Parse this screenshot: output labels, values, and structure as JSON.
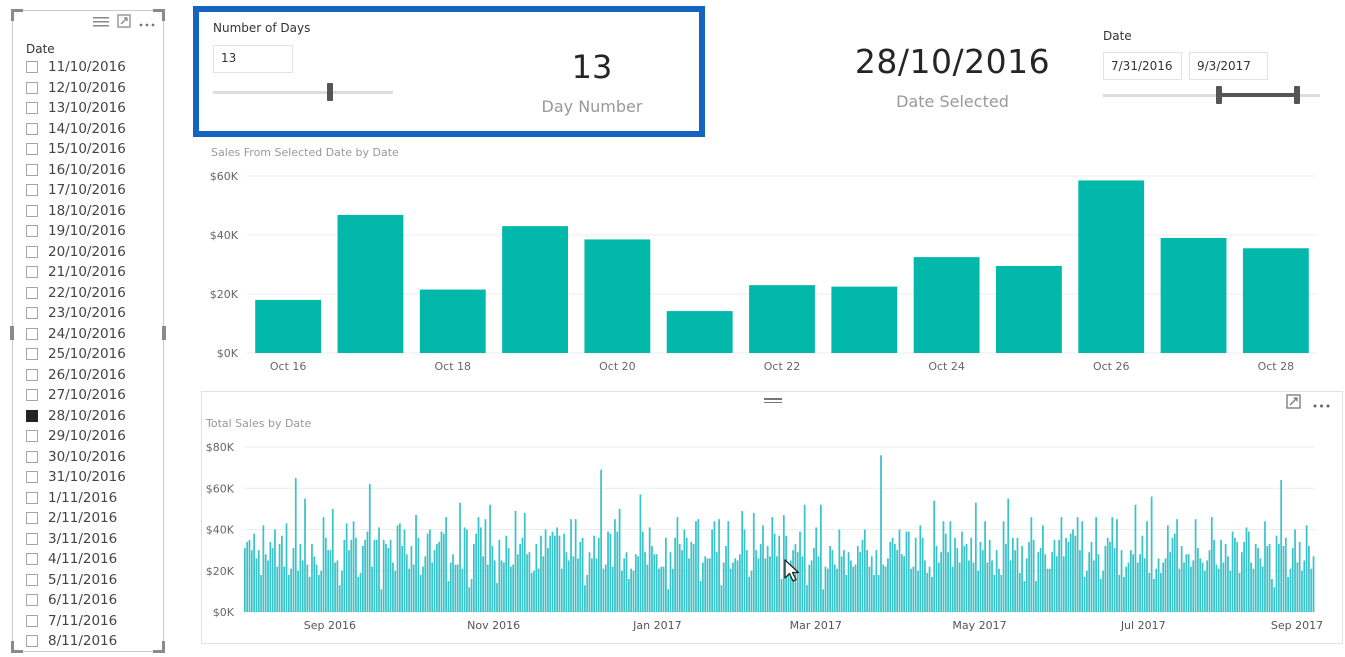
{
  "date_slicer": {
    "title": "Date",
    "items": [
      {
        "label": "11/10/2016",
        "checked": false
      },
      {
        "label": "12/10/2016",
        "checked": false
      },
      {
        "label": "13/10/2016",
        "checked": false
      },
      {
        "label": "14/10/2016",
        "checked": false
      },
      {
        "label": "15/10/2016",
        "checked": false
      },
      {
        "label": "16/10/2016",
        "checked": false
      },
      {
        "label": "17/10/2016",
        "checked": false
      },
      {
        "label": "18/10/2016",
        "checked": false
      },
      {
        "label": "19/10/2016",
        "checked": false
      },
      {
        "label": "20/10/2016",
        "checked": false
      },
      {
        "label": "21/10/2016",
        "checked": false
      },
      {
        "label": "22/10/2016",
        "checked": false
      },
      {
        "label": "23/10/2016",
        "checked": false
      },
      {
        "label": "24/10/2016",
        "checked": false
      },
      {
        "label": "25/10/2016",
        "checked": false
      },
      {
        "label": "26/10/2016",
        "checked": false
      },
      {
        "label": "27/10/2016",
        "checked": false
      },
      {
        "label": "28/10/2016",
        "checked": true
      },
      {
        "label": "29/10/2016",
        "checked": false
      },
      {
        "label": "30/10/2016",
        "checked": false
      },
      {
        "label": "31/10/2016",
        "checked": false
      },
      {
        "label": "1/11/2016",
        "checked": false
      },
      {
        "label": "2/11/2016",
        "checked": false
      },
      {
        "label": "3/11/2016",
        "checked": false
      },
      {
        "label": "4/11/2016",
        "checked": false
      },
      {
        "label": "5/11/2016",
        "checked": false
      },
      {
        "label": "6/11/2016",
        "checked": false
      },
      {
        "label": "7/11/2016",
        "checked": false
      },
      {
        "label": "8/11/2016",
        "checked": false
      }
    ],
    "icons": [
      "menu-lines-icon",
      "focus-mode-icon",
      "more-options-icon"
    ]
  },
  "number_of_days": {
    "title": "Number of Days",
    "input_value": "13",
    "slider_fraction": 0.65,
    "highlight_color": "#1565c0"
  },
  "day_number_card": {
    "value": "13",
    "caption": "Day Number"
  },
  "date_selected_card": {
    "value": "28/10/2016",
    "caption": "Date Selected"
  },
  "date_range": {
    "title": "Date",
    "start": "7/31/2016",
    "end": "9/3/2017"
  },
  "chart_data": [
    {
      "type": "bar",
      "title": "Sales From Selected Date by Date",
      "xlabel": "",
      "ylabel": "",
      "categories": [
        "Oct 16",
        "Oct 17",
        "Oct 18",
        "Oct 19",
        "Oct 20",
        "Oct 21",
        "Oct 22",
        "Oct 23",
        "Oct 24",
        "Oct 25",
        "Oct 26",
        "Oct 27",
        "Oct 28"
      ],
      "x_tick_labels": [
        "Oct 16",
        "Oct 18",
        "Oct 20",
        "Oct 22",
        "Oct 24",
        "Oct 26",
        "Oct 28"
      ],
      "values": [
        18000,
        46800,
        21500,
        43000,
        38500,
        14200,
        23000,
        22500,
        32500,
        29500,
        58500,
        39000,
        35500
      ],
      "y_ticks": [
        "$0K",
        "$20K",
        "$40K",
        "$60K"
      ],
      "ylim": [
        0,
        60000
      ],
      "grid": true,
      "color": "#01b8aa"
    },
    {
      "type": "bar",
      "title": "Total Sales by Date",
      "xlabel": "",
      "ylabel": "",
      "x_tick_labels": [
        "Sep 2016",
        "Nov 2016",
        "Jan 2017",
        "Mar 2017",
        "May 2017",
        "Jul 2017",
        "Sep 2017"
      ],
      "x_range": [
        "2016-07-31",
        "2017-09-03"
      ],
      "values": [
        31000,
        34000,
        35000,
        30000,
        38000,
        26000,
        30000,
        18000,
        42000,
        28000,
        25000,
        34000,
        31000,
        40000,
        22000,
        33000,
        37000,
        22000,
        43000,
        18000,
        21000,
        31000,
        65000,
        20000,
        33000,
        25000,
        55000,
        23000,
        17000,
        33000,
        27000,
        23000,
        18000,
        20000,
        46000,
        36000,
        30000,
        30000,
        50000,
        24000,
        25000,
        13000,
        20000,
        35000,
        43000,
        30000,
        35000,
        44000,
        36000,
        17000,
        19000,
        32000,
        35000,
        39000,
        62000,
        22000,
        35000,
        35000,
        41000,
        11000,
        35000,
        33000,
        31000,
        35000,
        24000,
        20000,
        42000,
        43000,
        32000,
        40000,
        28000,
        21000,
        32000,
        23000,
        47000,
        36000,
        18000,
        22000,
        27000,
        38000,
        40000,
        24000,
        30000,
        33000,
        34000,
        39000,
        38000,
        46000,
        15000,
        24000,
        28000,
        23000,
        23000,
        53000,
        21000,
        41000,
        40000,
        12000,
        16000,
        33000,
        38000,
        46000,
        41000,
        27000,
        45000,
        23000,
        52000,
        32000,
        25000,
        14000,
        35000,
        25000,
        24000,
        37000,
        31000,
        22000,
        23000,
        49000,
        28000,
        33000,
        36000,
        48000,
        28000,
        29000,
        19000,
        20000,
        33000,
        21000,
        37000,
        27000,
        40000,
        31000,
        37000,
        39000,
        37000,
        41000,
        37000,
        21000,
        38000,
        29000,
        25000,
        45000,
        27000,
        45000,
        26000,
        34000,
        36000,
        13000,
        18000,
        29000,
        26000,
        37000,
        26000,
        36000,
        69000,
        21000,
        23000,
        39000,
        38000,
        22000,
        45000,
        39000,
        50000,
        20000,
        26000,
        29000,
        16000,
        21000,
        20000,
        28000,
        27000,
        57000,
        39000,
        29000,
        23000,
        41000,
        32000,
        28000,
        28000,
        21000,
        22000,
        22000,
        36000,
        11000,
        29000,
        21000,
        36000,
        46000,
        33000,
        30000,
        40000,
        36000,
        26000,
        34000,
        33000,
        44000,
        45000,
        15000,
        24000,
        27000,
        26000,
        26000,
        40000,
        44000,
        29000,
        45000,
        13000,
        24000,
        32000,
        44000,
        21000,
        24000,
        26000,
        25000,
        28000,
        49000,
        40000,
        30000,
        17000,
        20000,
        48000,
        30000,
        26000,
        33000,
        42000,
        26000,
        32000,
        27000,
        46000,
        38000,
        27000,
        37000,
        16000,
        47000,
        37000,
        21000,
        25000,
        30000,
        33000,
        29000,
        39000,
        27000,
        52000,
        13000,
        23000,
        25000,
        31000,
        41000,
        27000,
        52000,
        11000,
        22000,
        21000,
        32000,
        30000,
        23000,
        21000,
        40000,
        27000,
        30000,
        18000,
        29000,
        25000,
        22000,
        23000,
        32000,
        29000,
        35000,
        40000,
        30000,
        22000,
        27000,
        18000,
        30000,
        18000,
        76000,
        23000,
        22000,
        26000,
        34000,
        36000,
        33000,
        30000,
        40000,
        28000,
        27000,
        39000,
        39000,
        21000,
        22000,
        36000,
        20000,
        42000,
        36000,
        25000,
        19000,
        22000,
        17000,
        54000,
        32000,
        24000,
        29000,
        44000,
        38000,
        29000,
        44000,
        22000,
        36000,
        31000,
        24000,
        39000,
        32000,
        33000,
        25000,
        36000,
        24000,
        53000,
        20000,
        34000,
        30000,
        44000,
        24000,
        35000,
        25000,
        18000,
        30000,
        21000,
        18000,
        44000,
        33000,
        55000,
        25000,
        36000,
        30000,
        36000,
        19000,
        32000,
        15000,
        26000,
        34000,
        46000,
        35000,
        15000,
        29000,
        31000,
        42000,
        28000,
        21000,
        21000,
        29000,
        35000,
        27000,
        35000,
        46000,
        27000,
        36000,
        34000,
        38000,
        40000,
        37000,
        46000,
        30000,
        44000,
        17000,
        20000,
        29000,
        34000,
        25000,
        46000,
        28000,
        16000,
        20000,
        32000,
        36000,
        34000,
        46000,
        31000,
        45000,
        18000,
        30000,
        17000,
        22000,
        24000,
        30000,
        28000,
        52000,
        24000,
        28000,
        37000,
        26000,
        44000,
        19000,
        56000,
        16000,
        21000,
        26000,
        19000,
        24000,
        26000,
        42000,
        29000,
        36000,
        38000,
        45000,
        21000,
        32000,
        24000,
        28000,
        28000,
        22000,
        25000,
        45000,
        31000,
        26000,
        24000,
        20000,
        25000,
        30000,
        46000,
        35000,
        23000,
        21000,
        35000,
        24000,
        33000,
        27000,
        20000,
        39000,
        36000,
        34000,
        19000,
        29000,
        34000,
        41000,
        39000,
        24000,
        21000,
        33000,
        31000,
        26000,
        22000,
        44000,
        32000,
        33000,
        16000,
        12000,
        37000,
        33000,
        64000,
        32000,
        36000,
        17000,
        21000,
        31000,
        40000,
        24000,
        34000,
        20000,
        25000,
        42000,
        32000,
        21000,
        27000
      ],
      "y_ticks": [
        "$0K",
        "$20K",
        "$40K",
        "$60K",
        "$80K"
      ],
      "ylim": [
        0,
        80000
      ],
      "grid": true,
      "color": "#01b8aa"
    }
  ],
  "chart2_icons": [
    "focus-mode-icon",
    "more-options-icon"
  ]
}
